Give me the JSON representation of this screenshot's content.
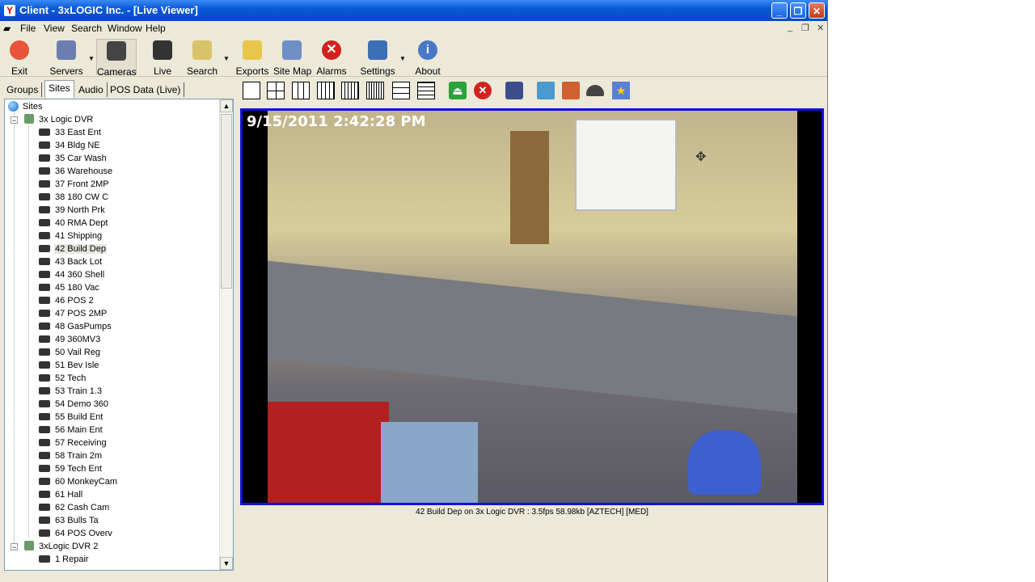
{
  "window": {
    "title": "Client - 3xLOGIC Inc. - [Live Viewer]",
    "app_icon": "Y",
    "controls": [
      "_",
      "❐",
      "✕"
    ]
  },
  "menubar": {
    "items": [
      "File",
      "View",
      "Search",
      "Window",
      "Help"
    ],
    "mdi_controls": [
      "_",
      "❐",
      "✕"
    ]
  },
  "toolbar": {
    "items": [
      {
        "label": "Exit",
        "icon": "power-icon",
        "color": "#e8533a"
      },
      {
        "label": "Servers",
        "icon": "servers-icon",
        "color": "#6a7fb0"
      },
      {
        "label": "Cameras",
        "icon": "cameras-icon",
        "color": "#444444"
      },
      {
        "label": "Live",
        "icon": "live-camera-icon",
        "color": "#333333"
      },
      {
        "label": "Search",
        "icon": "search-icon",
        "color": "#d9c36a"
      },
      {
        "label": "Exports",
        "icon": "exports-icon",
        "color": "#e8c64a"
      },
      {
        "label": "Site Map",
        "icon": "site-map-icon",
        "color": "#6f8fc7"
      },
      {
        "label": "Alarms",
        "icon": "alarms-icon",
        "color": "#d42020"
      },
      {
        "label": "Settings",
        "icon": "settings-icon",
        "color": "#3c6fb5"
      },
      {
        "label": "About",
        "icon": "about-icon",
        "color": "#4a78c8"
      }
    ]
  },
  "tabs": [
    "Groups",
    "Sites",
    "Audio",
    "POS Data (Live)"
  ],
  "tree": {
    "root": "Sites",
    "dvr1": "3x Logic DVR",
    "cameras": [
      "33  East Ent",
      "34 Bldg NE",
      "35 Car Wash",
      "36 Warehouse",
      "37 Front 2MP",
      "38 180 CW C",
      "39 North Prk",
      "40  RMA Dept",
      "41 Shipping",
      "42 Build Dep",
      "43 Back Lot",
      "44 360 Shell",
      "45 180 Vac",
      "46  POS 2",
      "47  POS 2MP",
      "48 GasPumps",
      "49 360MV3",
      "50 Vail Reg",
      "51 Bev Isle",
      "52 Tech",
      "53 Train 1.3",
      "54 Demo 360",
      "55 Build Ent",
      "56 Main Ent",
      "57 Receiving",
      "58 Train 2m",
      "59 Tech Ent",
      "60 MonkeyCam",
      "61 Hall",
      "62 Cash Cam",
      "63  Bulls Ta",
      "64 POS Overv"
    ],
    "selected": "42 Build Dep",
    "dvr2": "3xLogic DVR 2",
    "dvr2_cameras": [
      "1 Repair"
    ]
  },
  "video": {
    "timestamp": "9/15/2011 2:42:28 PM",
    "caption": "42 Build Dep on 3x Logic DVR : 3.5fps 58.98kb [AZTECH] [MED]"
  },
  "colors": {
    "video_border": "#1010e0",
    "title_bar": "#0a5ad8",
    "chrome": "#ece9d8"
  }
}
